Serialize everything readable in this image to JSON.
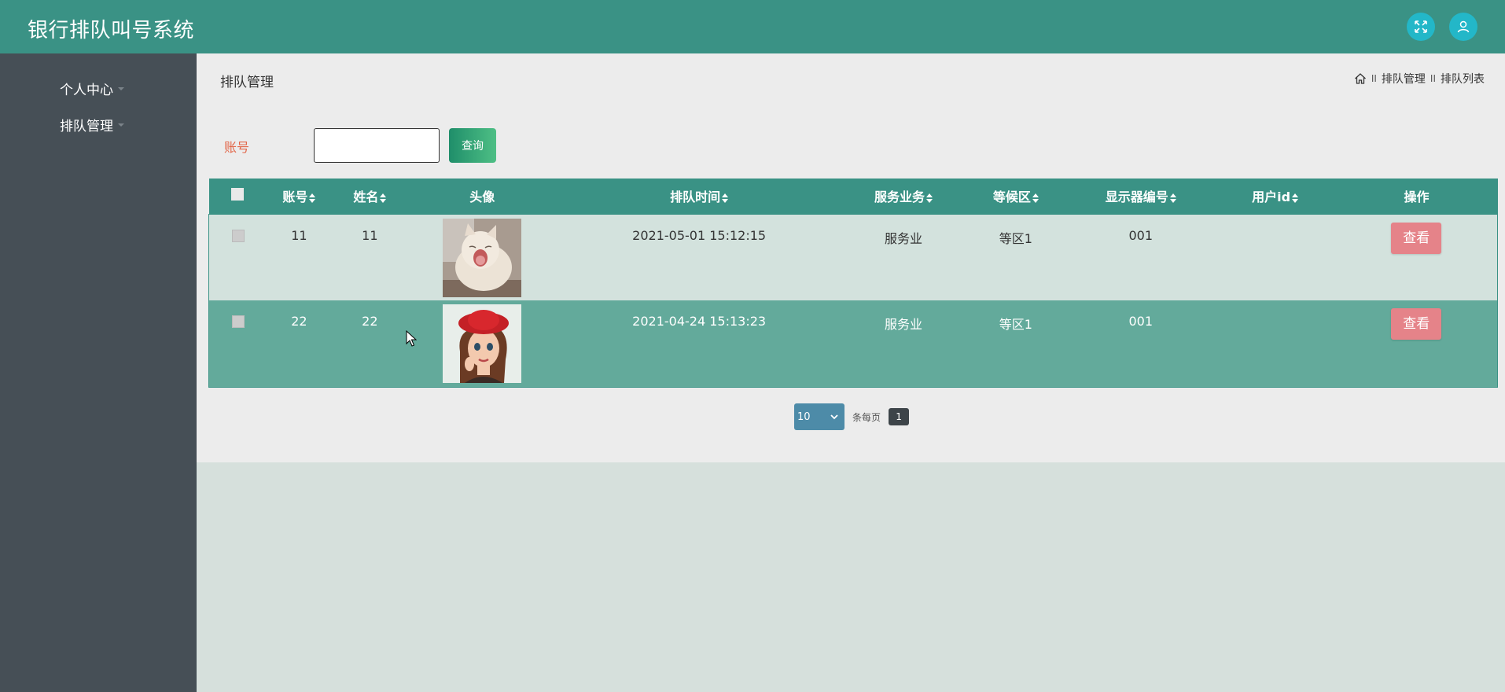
{
  "app": {
    "title": "银行排队叫号系统"
  },
  "icons": {
    "fullscreen": "fullscreen-icon",
    "user": "user-icon",
    "home": "home-icon"
  },
  "colors": {
    "header": "#3a9285",
    "sidebar": "#464f56",
    "view_button": "#e58389",
    "search_button": "#2f9e75"
  },
  "sidebar": {
    "items": [
      {
        "label": "个人中心"
      },
      {
        "label": "排队管理"
      }
    ]
  },
  "page": {
    "title": "排队管理",
    "breadcrumb": {
      "sep": "II",
      "items": [
        "排队管理",
        "排队列表"
      ]
    }
  },
  "search": {
    "label": "账号",
    "value": "",
    "button_label": "查询"
  },
  "table": {
    "headers": [
      "账号",
      "姓名",
      "头像",
      "排队时间",
      "服务业务",
      "等候区",
      "显示器编号",
      "用户id",
      "操作"
    ],
    "rows": [
      {
        "account": "11",
        "name": "11",
        "avatar": "cat-photo",
        "time": "2021-05-01 15:12:15",
        "service": "服务业",
        "area": "等区1",
        "display": "001",
        "userid": "",
        "action": "查看"
      },
      {
        "account": "22",
        "name": "22",
        "avatar": "cartoon-girl-photo",
        "time": "2021-04-24 15:13:23",
        "service": "服务业",
        "area": "等区1",
        "display": "001",
        "userid": "",
        "action": "查看"
      }
    ]
  },
  "pagination": {
    "page_size": "10",
    "per_page_label": "条每页",
    "current_page": "1"
  }
}
